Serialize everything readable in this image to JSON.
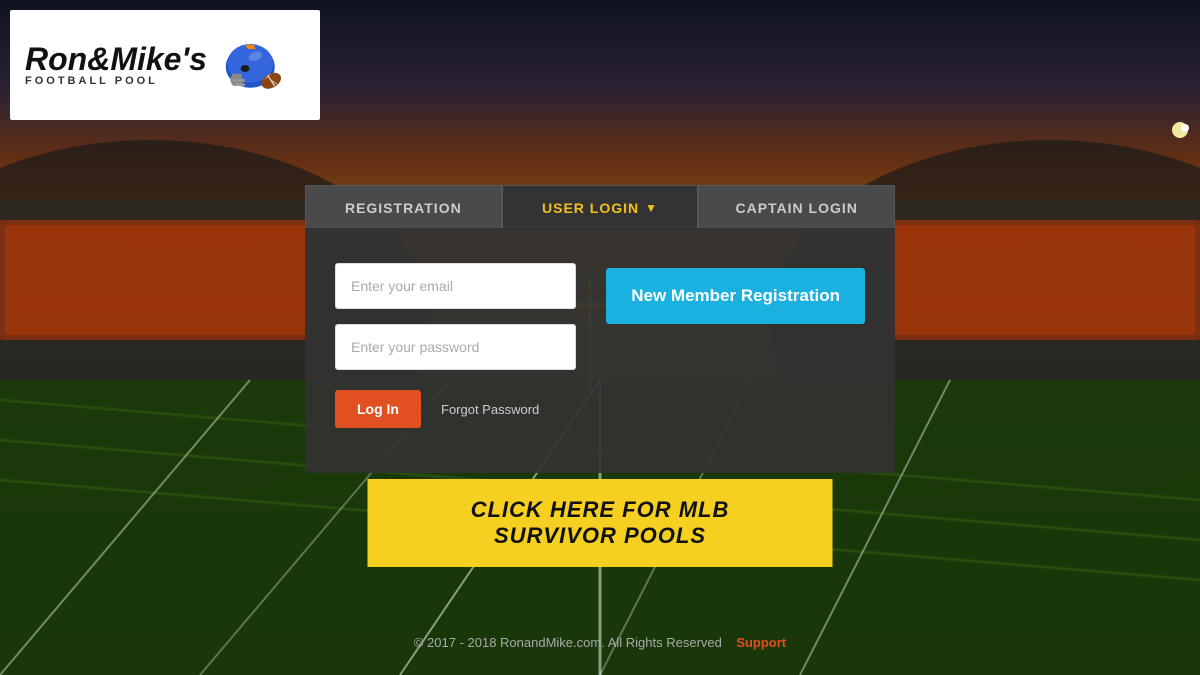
{
  "logo": {
    "title": "Ron&Mike's",
    "subtitle": "FOOTBALL POOL"
  },
  "nav": {
    "tabs": [
      {
        "id": "registration",
        "label": "REGISTRATION"
      },
      {
        "id": "user-login",
        "label": "USER LOGIN",
        "active": true
      },
      {
        "id": "captain-login",
        "label": "CAPTAIN LOGIN"
      }
    ]
  },
  "form": {
    "email_placeholder": "Enter your email",
    "password_placeholder": "Enter your password",
    "login_button": "Log In",
    "forgot_password": "Forgot Password"
  },
  "registration": {
    "button": "New Member Registration"
  },
  "mlb_banner": {
    "text": "CLICK HERE FOR MLB SURVIVOR POOLS"
  },
  "footer": {
    "copyright": "© 2017 - 2018 RonandMike.com. All Rights Reserved",
    "support_label": "Support"
  },
  "colors": {
    "accent_orange": "#e05020",
    "accent_yellow": "#f0c020",
    "accent_blue": "#1ab0e0",
    "nav_active_text": "#f0c020"
  }
}
